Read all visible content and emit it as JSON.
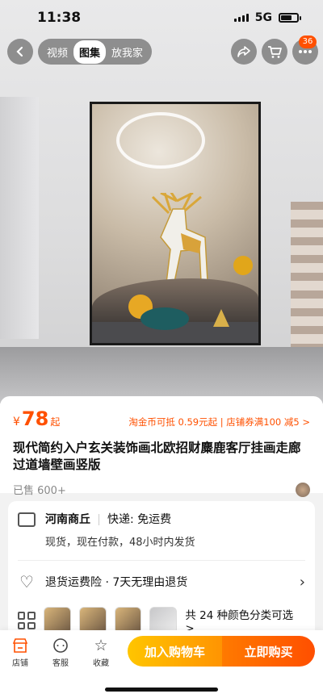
{
  "status_bar": {
    "time": "11:38",
    "network": "5G"
  },
  "top_tabs": [
    {
      "label": "视频",
      "active": false
    },
    {
      "label": "图集",
      "active": true
    },
    {
      "label": "放我家",
      "active": false
    }
  ],
  "cart_badge": "36",
  "product": {
    "currency": "¥",
    "price": "78",
    "price_suffix": "起",
    "promo": "淘金币可抵 0.59元起 | 店铺券满100 减5 >",
    "title": "现代简约入户玄关装饰画北欧招财麋鹿客厅挂画走廊过道墙壁画竖版",
    "sold": "已售 600+"
  },
  "shipping": {
    "location": "河南商丘",
    "delivery": "快递: 免运费",
    "detail": "现货，现在付款，48小时内发货"
  },
  "returns": {
    "text": "退货运费险 · 7天无理由退货"
  },
  "sku": {
    "text": "共 24 种颜色分类可选 >"
  },
  "bottom_nav": [
    {
      "label": "店铺",
      "icon": "store-icon"
    },
    {
      "label": "客服",
      "icon": "chat-icon"
    },
    {
      "label": "收藏",
      "icon": "star-icon"
    }
  ],
  "actions": {
    "add_to_cart": "加入购物车",
    "buy_now": "立即购买"
  },
  "colors": {
    "accent": "#ff5000",
    "cart_button": "#ffa800",
    "buy_button": "#ff5a00"
  }
}
